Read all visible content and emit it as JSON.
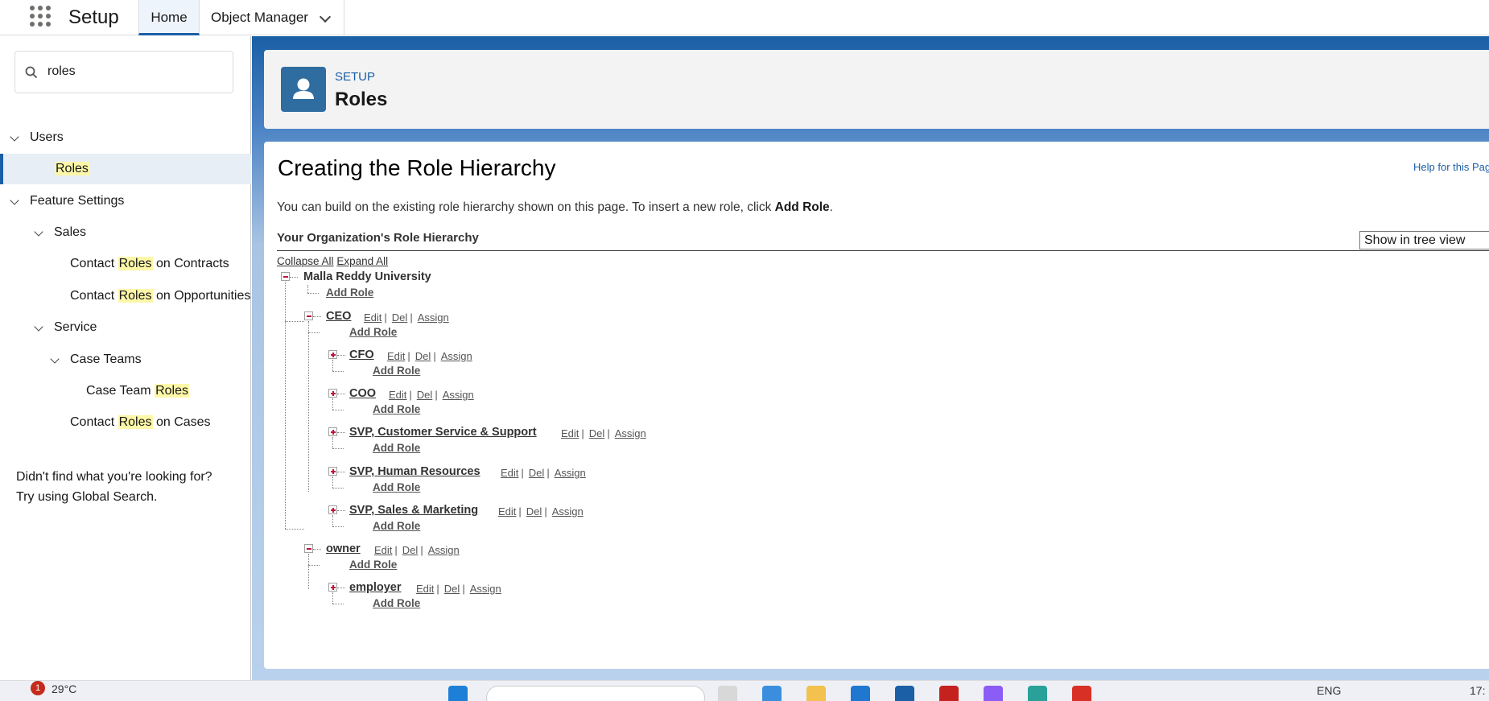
{
  "topbar": {
    "app_name": "Setup",
    "tabs": [
      {
        "label": "Home"
      },
      {
        "label": "Object Manager"
      }
    ]
  },
  "sidebar": {
    "search_value": "roles",
    "items": [
      {
        "label": "Users"
      },
      {
        "label": "Roles"
      },
      {
        "label": "Feature Settings"
      },
      {
        "label": "Sales"
      },
      {
        "label_before": "Contact ",
        "highlight": "Roles",
        "label_after": " on Contracts"
      },
      {
        "label_before": "Contact ",
        "highlight": "Roles",
        "label_after": " on Opportunities"
      },
      {
        "label": "Service"
      },
      {
        "label": "Case Teams"
      },
      {
        "label_before": "Case Team ",
        "highlight": "Roles",
        "label_after": ""
      },
      {
        "label_before": "Contact ",
        "highlight": "Roles",
        "label_after": " on Cases"
      }
    ],
    "not_found_line1": "Didn't find what you're looking for?",
    "not_found_line2": "Try using Global Search."
  },
  "header": {
    "eyebrow": "SETUP",
    "title": "Roles"
  },
  "content": {
    "heading": "Creating the Role Hierarchy",
    "help_link": "Help for this Page",
    "intro_text": "You can build on the existing role hierarchy shown on this page. To insert a new role, click ",
    "intro_bold": "Add Role",
    "intro_end": ".",
    "org_heading": "Your Organization's Role Hierarchy",
    "view_select": "Show in tree view",
    "collapse_all": "Collapse All",
    "expand_all": "Expand All",
    "root": "Malla Reddy University",
    "add_role": "Add Role",
    "actions": {
      "edit": "Edit",
      "sep": "|",
      "del": "Del",
      "assign": "Assign"
    },
    "roles": {
      "ceo": "CEO",
      "cfo": "CFO",
      "coo": "COO",
      "svp_cs": "SVP, Customer Service & Support",
      "svp_hr": "SVP, Human Resources",
      "svp_sm": "SVP, Sales & Marketing",
      "owner": "owner",
      "employer": "employer"
    }
  },
  "taskbar": {
    "weather": "29°C",
    "badge": "1",
    "lang": "ENG",
    "clock": "17:"
  }
}
